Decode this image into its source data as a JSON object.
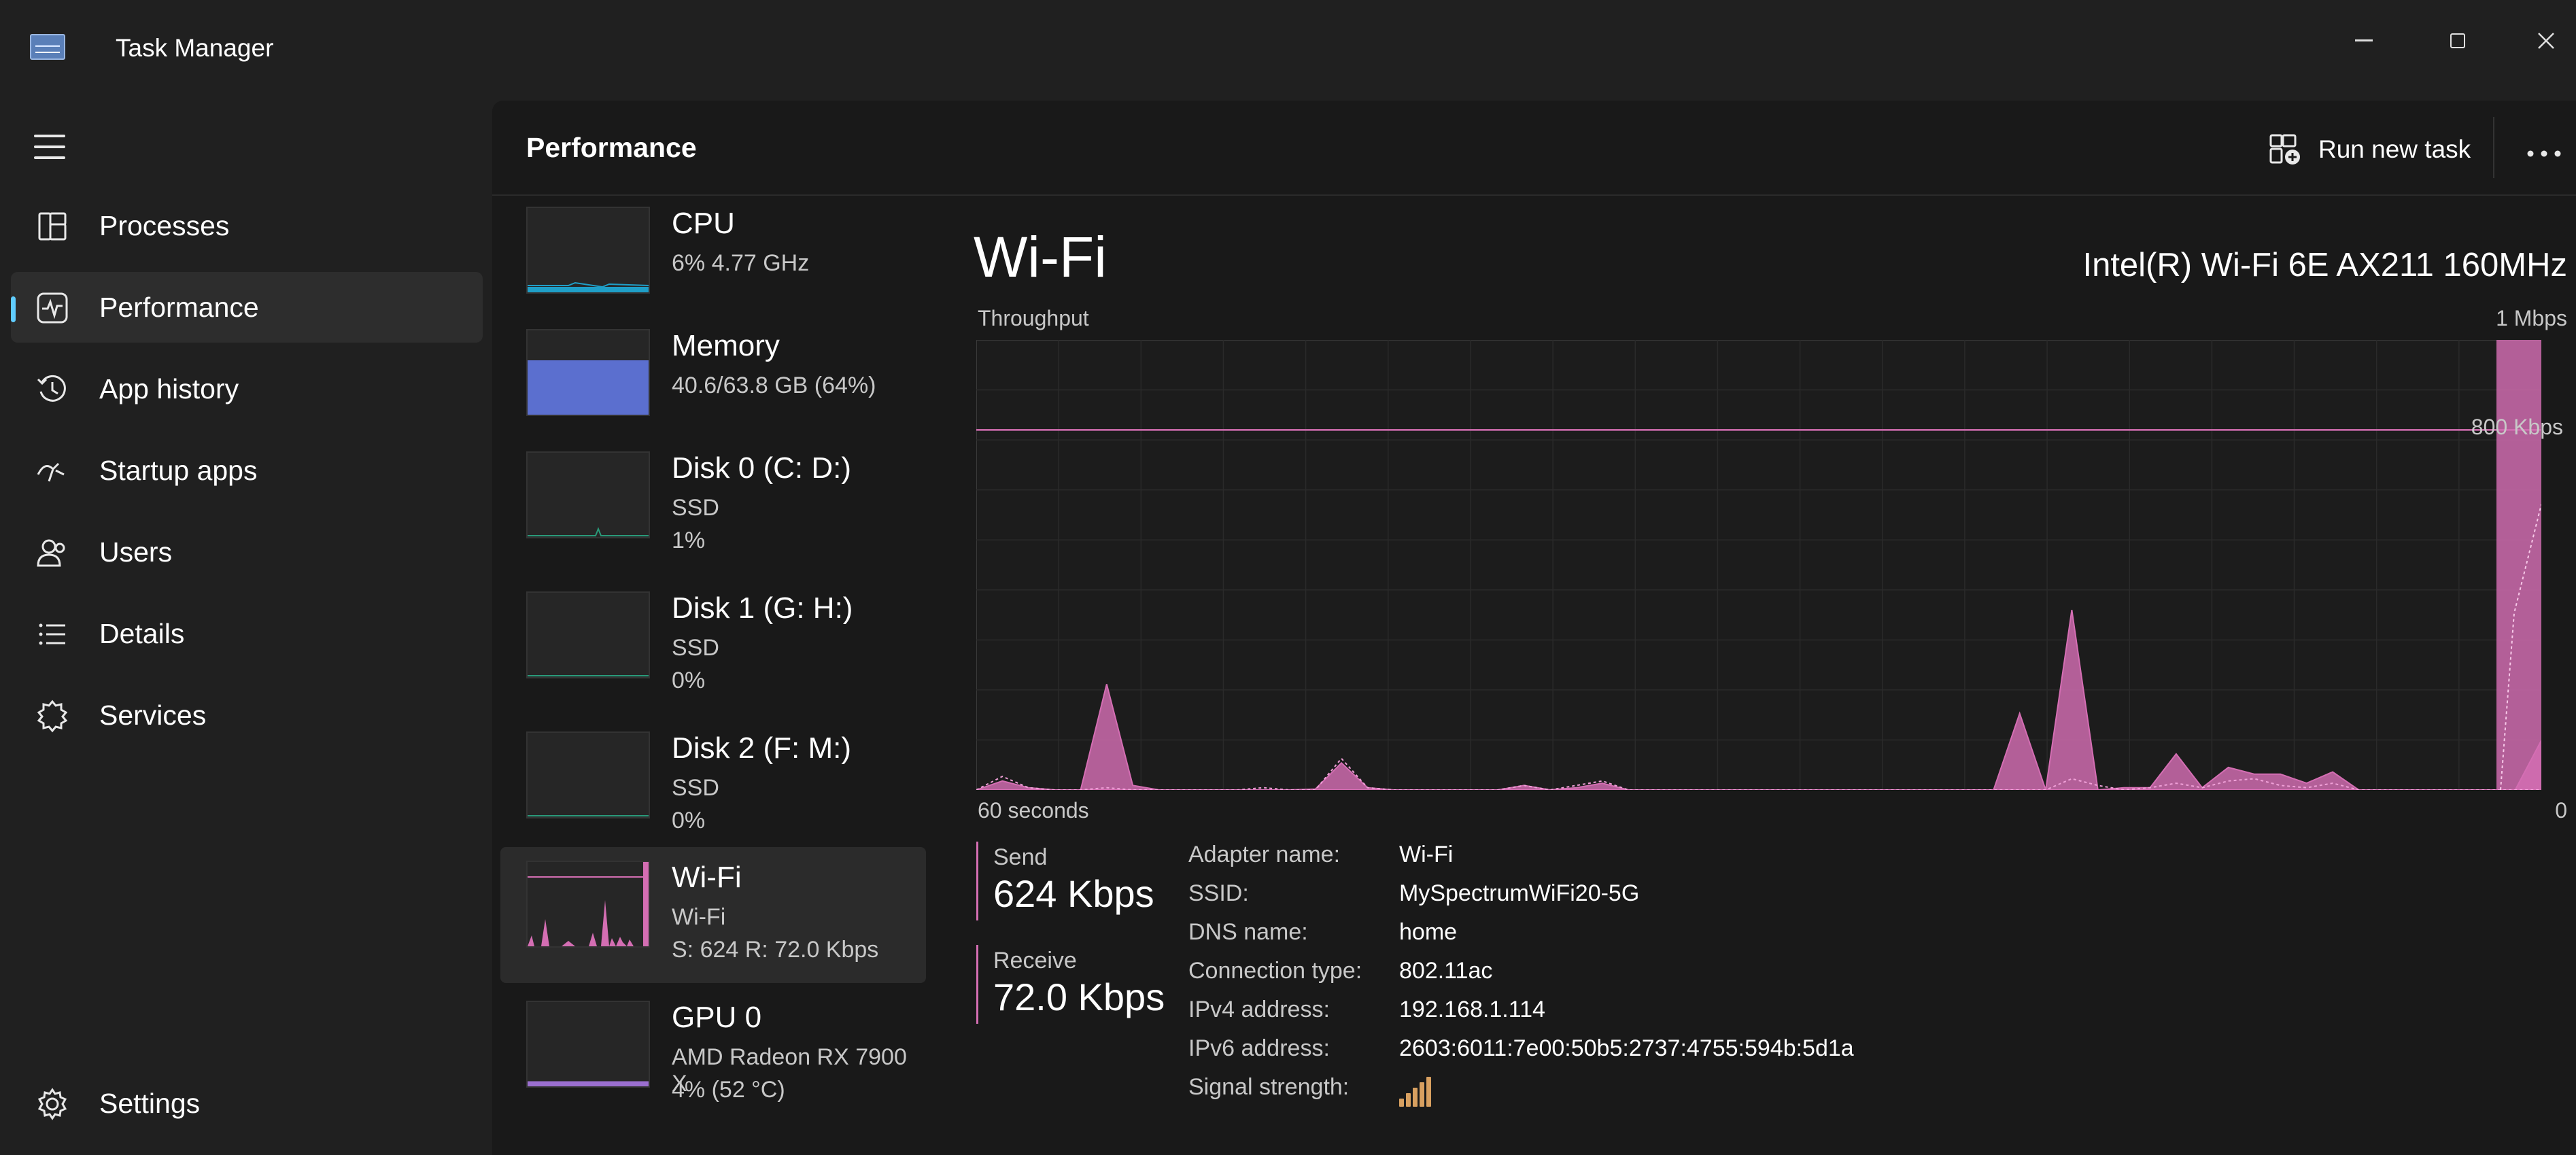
{
  "app": {
    "title": "Task Manager"
  },
  "nav": {
    "items": [
      {
        "id": "processes",
        "label": "Processes",
        "icon": "processes-icon",
        "active": false
      },
      {
        "id": "performance",
        "label": "Performance",
        "icon": "performance-icon",
        "active": true
      },
      {
        "id": "app-history",
        "label": "App history",
        "icon": "history-icon",
        "active": false
      },
      {
        "id": "startup-apps",
        "label": "Startup apps",
        "icon": "startup-icon",
        "active": false
      },
      {
        "id": "users",
        "label": "Users",
        "icon": "users-icon",
        "active": false
      },
      {
        "id": "details",
        "label": "Details",
        "icon": "details-list-icon",
        "active": false
      },
      {
        "id": "services",
        "label": "Services",
        "icon": "services-icon",
        "active": false
      }
    ],
    "settings_label": "Settings"
  },
  "header": {
    "title": "Performance",
    "run_task_label": "Run new task"
  },
  "devices": [
    {
      "id": "cpu",
      "name": "CPU",
      "sub1": "6%  4.77 GHz",
      "sub2": "",
      "active": false,
      "thumb_color": "#1f9fc8",
      "level": 0.06
    },
    {
      "id": "memory",
      "name": "Memory",
      "sub1": "40.6/63.8 GB (64%)",
      "sub2": "",
      "active": false,
      "thumb_color": "#5b6fcf",
      "level": 0.64
    },
    {
      "id": "disk0",
      "name": "Disk 0 (C: D:)",
      "sub1": "SSD",
      "sub2": "1%",
      "active": false,
      "thumb_color": "#2a9a7a",
      "level": 0.01
    },
    {
      "id": "disk1",
      "name": "Disk 1 (G: H:)",
      "sub1": "SSD",
      "sub2": "0%",
      "active": false,
      "thumb_color": "#2a9a7a",
      "level": 0
    },
    {
      "id": "disk2",
      "name": "Disk 2 (F: M:)",
      "sub1": "SSD",
      "sub2": "0%",
      "active": false,
      "thumb_color": "#2a9a7a",
      "level": 0
    },
    {
      "id": "wifi",
      "name": "Wi-Fi",
      "sub1": "Wi-Fi",
      "sub2": "S: 624  R: 72.0 Kbps",
      "active": true,
      "thumb_color": "#d46eb3",
      "level": 0.62
    },
    {
      "id": "gpu0",
      "name": "GPU 0",
      "sub1": "AMD Radeon RX 7900 X",
      "sub2": "4%  (52 °C)",
      "active": false,
      "thumb_color": "#9b6fd0",
      "level": 0.04
    }
  ],
  "main": {
    "title": "Wi-Fi",
    "adapter_full": "Intel(R) Wi-Fi 6E AX211 160MHz",
    "send_label": "Send",
    "send_value": "624 Kbps",
    "receive_label": "Receive",
    "receive_value": "72.0 Kbps",
    "properties": [
      {
        "key": "Adapter name:",
        "value": "Wi-Fi"
      },
      {
        "key": "SSID:",
        "value": "MySpectrumWiFi20-5G"
      },
      {
        "key": "DNS name:",
        "value": "home"
      },
      {
        "key": "Connection type:",
        "value": "802.11ac"
      },
      {
        "key": "IPv4 address:",
        "value": "192.168.1.114"
      },
      {
        "key": "IPv6 address:",
        "value": "2603:6011:7e00:50b5:2737:4755:594b:5d1a"
      }
    ],
    "signal_label": "Signal strength:",
    "signal_bars": 5
  },
  "chart_data": {
    "type": "area",
    "title": "Throughput",
    "xlabel_left": "60 seconds",
    "xlabel_right": "0",
    "ymax_label": "1 Mbps",
    "yref_label": "800 Kbps",
    "ylim": [
      0,
      1000
    ],
    "yref": 800,
    "color": "#d46eb3",
    "x": [
      60,
      59,
      58,
      57,
      56,
      55,
      54,
      53,
      52,
      51,
      50,
      49,
      48,
      47,
      46,
      45,
      44,
      43,
      42,
      41,
      40,
      39,
      38,
      37,
      36,
      35,
      34,
      33,
      32,
      31,
      30,
      29,
      28,
      27,
      26,
      25,
      24,
      23,
      22,
      21,
      20,
      19,
      18,
      17,
      16,
      15,
      14,
      13,
      12,
      11,
      10,
      9,
      8,
      7,
      6,
      5,
      4,
      3,
      2,
      1,
      0
    ],
    "series": [
      {
        "name": "Send",
        "values": [
          0,
          20,
          5,
          0,
          0,
          235,
          10,
          0,
          0,
          0,
          0,
          0,
          0,
          2,
          60,
          5,
          0,
          0,
          0,
          0,
          0,
          10,
          0,
          5,
          15,
          0,
          0,
          0,
          0,
          0,
          0,
          0,
          0,
          0,
          0,
          0,
          0,
          0,
          0,
          0,
          170,
          0,
          400,
          0,
          5,
          5,
          80,
          5,
          50,
          35,
          35,
          15,
          40,
          0,
          0,
          0,
          0,
          0,
          0,
          0,
          110
        ]
      },
      {
        "name": "Receive",
        "values": [
          0,
          30,
          5,
          0,
          0,
          5,
          0,
          0,
          0,
          0,
          0,
          5,
          0,
          0,
          70,
          5,
          0,
          0,
          0,
          0,
          0,
          10,
          0,
          10,
          20,
          0,
          0,
          0,
          0,
          0,
          0,
          0,
          0,
          0,
          0,
          0,
          0,
          0,
          0,
          0,
          0,
          0,
          25,
          10,
          0,
          5,
          15,
          5,
          20,
          25,
          10,
          5,
          15,
          0,
          0,
          0,
          0,
          0,
          0,
          0,
          0
        ]
      }
    ],
    "x_grid_lines": 19,
    "y_grid_lines": 9
  }
}
